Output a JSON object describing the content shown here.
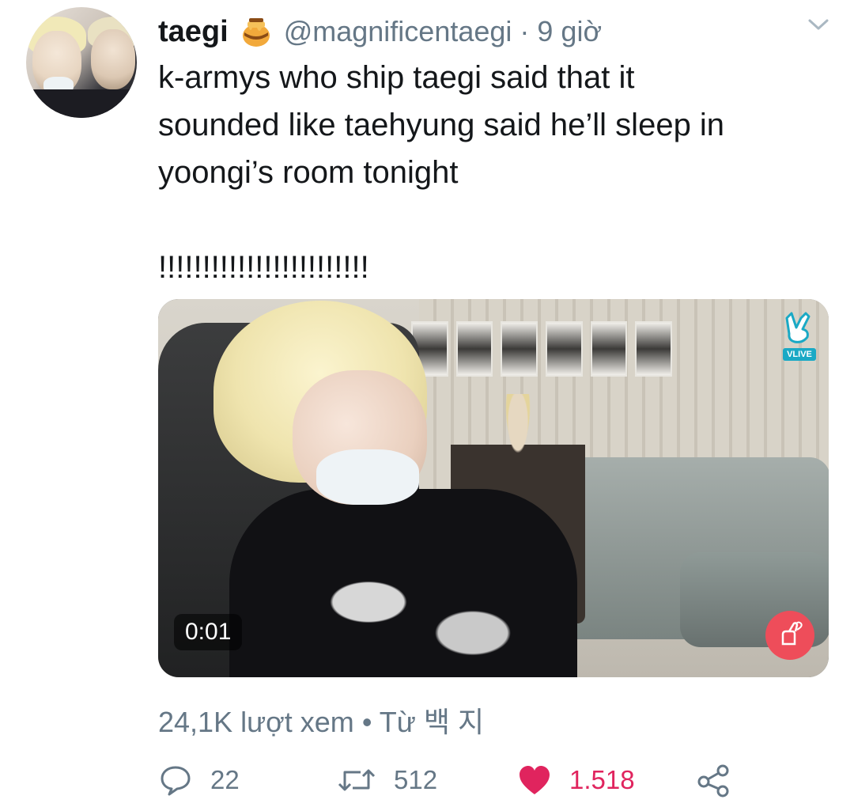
{
  "tweet": {
    "author_name": "taegi",
    "author_handle": "@magnificentaegi",
    "time": "· 9 giờ",
    "text": "k-armys who ship taegi said that it\nsounded like taehyung said he’ll sleep in\nyoongi’s room tonight\n\n!!!!!!!!!!!!!!!!!!!!!!!!",
    "media": {
      "duration": "0:01",
      "watermark": "VLIVE"
    },
    "views": "24,1K lượt xem",
    "source": "• Từ 백 지",
    "actions": {
      "replies": "22",
      "retweets": "512",
      "likes": "1.518"
    }
  },
  "colors": {
    "text": "#14171a",
    "muted": "#657786",
    "like": "#e0245e",
    "heart_button": "#ee4d5a"
  },
  "icons": [
    "honey-pot-icon",
    "chevron-down-icon",
    "vlive-logo-icon",
    "finger-heart-icon",
    "reply-icon",
    "retweet-icon",
    "like-icon",
    "share-icon"
  ]
}
